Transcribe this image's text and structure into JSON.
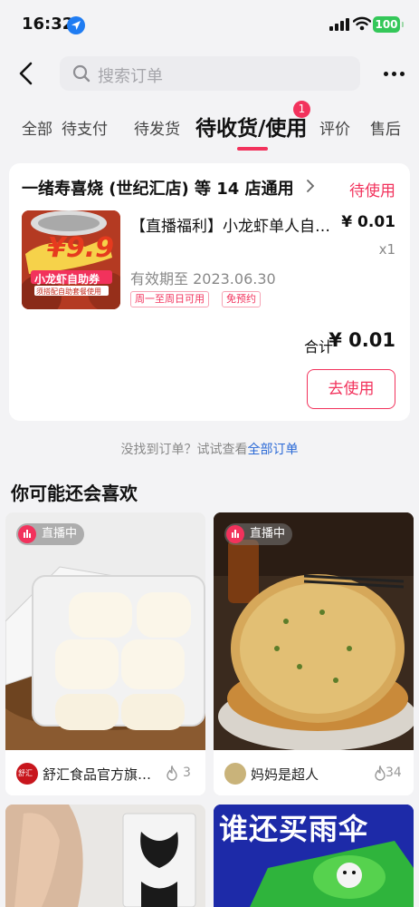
{
  "status_bar": {
    "time": "16:32",
    "battery": "100"
  },
  "header": {
    "search_placeholder": "搜索订单"
  },
  "tabs": [
    {
      "label": "全部"
    },
    {
      "label": "待支付"
    },
    {
      "label": "待发货"
    },
    {
      "label": "待收货/使用",
      "active": true,
      "badge": "1"
    },
    {
      "label": "评价"
    },
    {
      "label": "售后"
    }
  ],
  "order": {
    "shop_name": "一绪寿喜烧 (世纪汇店) 等 14 店通用",
    "status": "待使用",
    "image": {
      "price_text": "¥9.9",
      "banner_text": "小龙虾自助券",
      "sub_text": "须搭配自助套餐使用"
    },
    "product_title": "【直播福利】小龙虾单人自助券",
    "price": "¥ 0.01",
    "quantity": "x1",
    "validity": "有效期至 2023.06.30",
    "tags": [
      "周一至周日可用",
      "免预约"
    ],
    "total_label": "合计",
    "total_value": "¥ 0.01",
    "use_button": "去使用"
  },
  "not_found": {
    "text": "没找到订单？试试查看",
    "link": "全部订单"
  },
  "recommend": {
    "title": "你可能还会喜欢",
    "items": [
      {
        "badge": "直播中",
        "store": "舒汇食品官方旗舰店",
        "likes": "3",
        "avatar_text": "舒汇"
      },
      {
        "badge": "直播中",
        "store": "妈妈是超人",
        "likes": "34"
      },
      {
        "store": "",
        "likes": ""
      },
      {
        "headline": "谁还买雨伞",
        "store": "",
        "likes": ""
      }
    ]
  },
  "colors": {
    "accent": "#f2325c",
    "link": "#2a69d6",
    "battery": "#34c759",
    "background": "#f3f3f5"
  }
}
